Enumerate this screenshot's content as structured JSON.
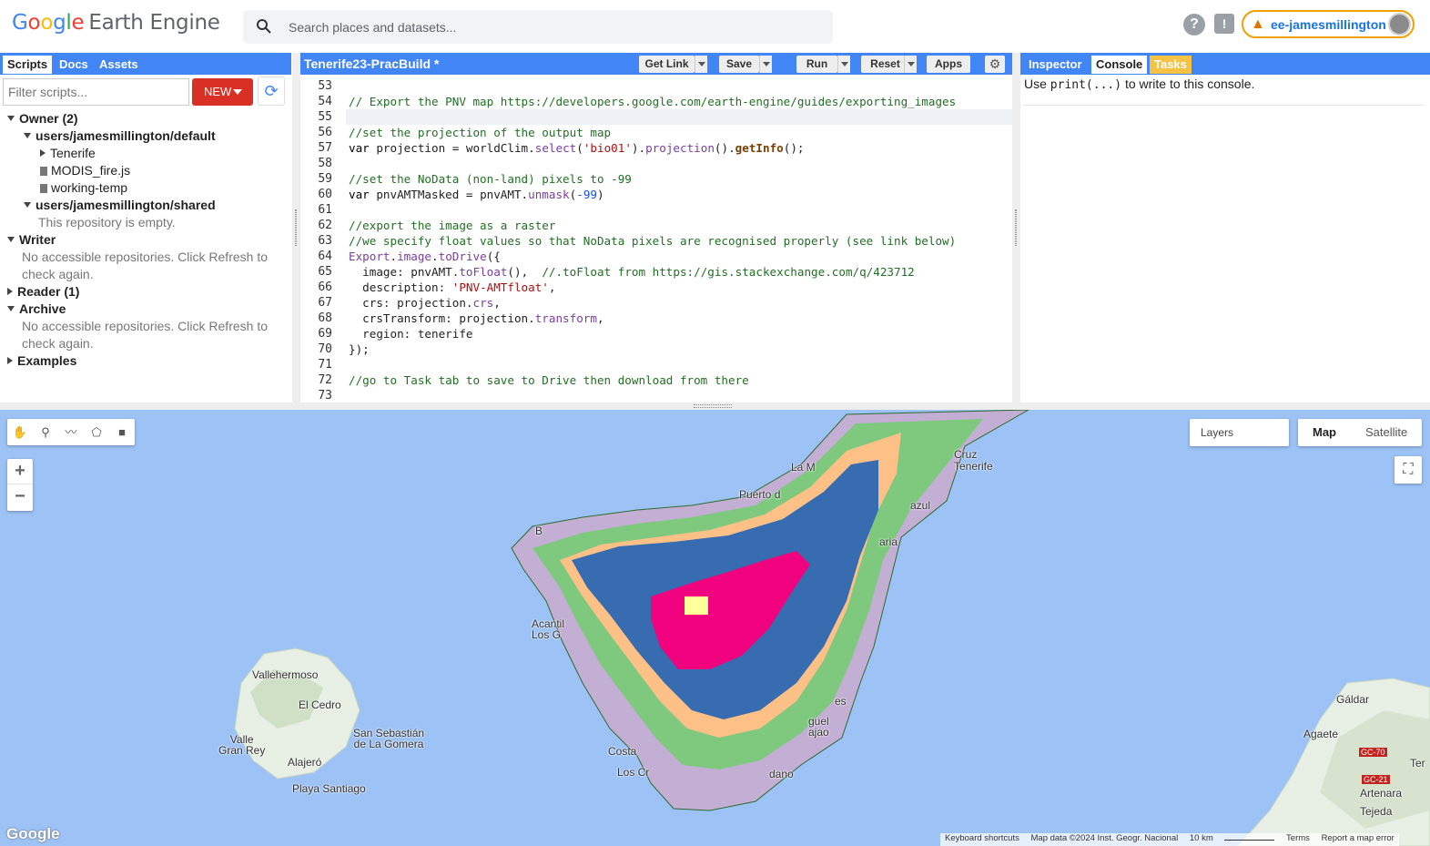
{
  "header": {
    "logo_google": [
      "G",
      "o",
      "o",
      "g",
      "l",
      "e"
    ],
    "logo_product": "Earth Engine",
    "search_placeholder": "Search places and datasets...",
    "help_icon": "?",
    "feedback_icon": "!",
    "account_name": "ee-jamesmillington"
  },
  "left_panel": {
    "tabs": [
      "Scripts",
      "Docs",
      "Assets"
    ],
    "filter_placeholder": "Filter scripts...",
    "new_label": "NEW",
    "tree": {
      "owner": "Owner (2)",
      "default_repo": "users/jamesmillington/default",
      "tenerife_folder": "Tenerife",
      "file1": "MODIS_fire.js",
      "file2": "working-temp",
      "shared_repo": "users/jamesmillington/shared",
      "shared_empty": "This repository is empty.",
      "writer": "Writer",
      "writer_msg1": "No accessible repositories. Click Refresh to",
      "writer_msg2": "check again.",
      "reader": "Reader (1)",
      "archive": "Archive",
      "archive_msg1": "No accessible repositories. Click Refresh to",
      "archive_msg2": "check again.",
      "examples": "Examples"
    }
  },
  "editor": {
    "title": "Tenerife23-PracBuild *",
    "buttons": {
      "get_link": "Get Link",
      "save": "Save",
      "run": "Run",
      "reset": "Reset",
      "apps": "Apps"
    },
    "line_numbers": [
      "53",
      "54",
      "55",
      "56",
      "57",
      "58",
      "59",
      "60",
      "61",
      "62",
      "63",
      "64",
      "65",
      "66",
      "67",
      "68",
      "69",
      "70",
      "71",
      "72",
      "73"
    ]
  },
  "right_panel": {
    "tabs": [
      "Inspector",
      "Console",
      "Tasks"
    ],
    "console_pre": "Use ",
    "console_code": "print(...)",
    "console_post": " to write to this console."
  },
  "map": {
    "layers_label": "Layers",
    "map_type": [
      "Map",
      "Satellite"
    ],
    "zoom_in": "+",
    "zoom_out": "−",
    "labels": {
      "vallehermoso": "Vallehermoso",
      "el_cedro": "El Cedro",
      "valle_gran_rey": "Valle\nGran Rey",
      "san_sebastian": "San Sebastián\nde La Gomera",
      "alajero": "Alajeró",
      "playa_santiago": "Playa Santiago",
      "acantilado": "Acantil\nLos G",
      "costa": "Costa",
      "los_cr": "Los Cr",
      "aria": "aria",
      "santa_cruz": "Cruz\nTenerife",
      "la_m": "La M",
      "puerto": "Puerto d",
      "azul": "azul",
      "es": "es",
      "guel": "guel\najao",
      "dano": "dano",
      "galdar": "Gáldar",
      "agaete": "Agaete",
      "artenara": "Artenara",
      "tejeda": "Tejeda",
      "ter": "Ter",
      "gc70": "GC-70",
      "gc21": "GC-21",
      "b": "B"
    },
    "google_logo": "Google",
    "attribution": {
      "shortcuts": "Keyboard shortcuts",
      "data": "Map data ©2024 Inst. Geogr. Nacional",
      "scale": "10 km",
      "terms": "Terms",
      "report": "Report a map error"
    }
  },
  "colors": {
    "accent": "#4285f4",
    "new_button": "#d93025",
    "class1": "#c3aed4",
    "class2": "#7fc97f",
    "class3": "#fdc086",
    "class4": "#386cb0",
    "class5": "#f0027f",
    "class6": "#ffff99"
  }
}
